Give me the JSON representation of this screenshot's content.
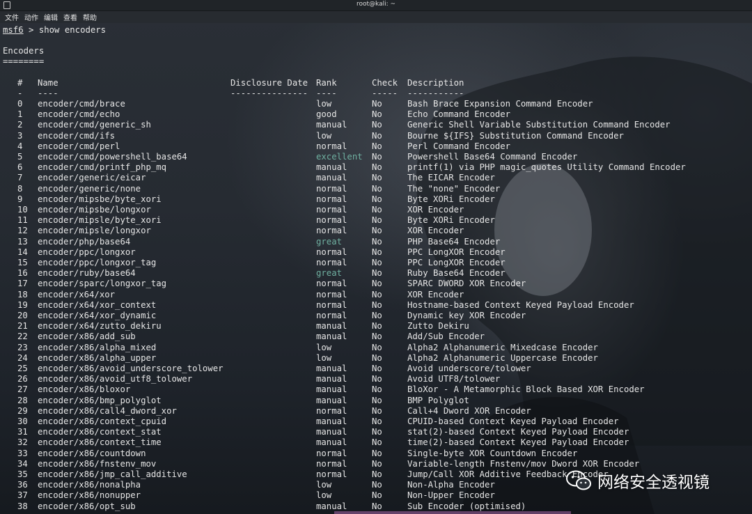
{
  "window": {
    "title": "root@kali: ~"
  },
  "menu": [
    "文件",
    "动作",
    "编辑",
    "查看",
    "帮助"
  ],
  "prompt": {
    "name": "msf6",
    "separator": " > ",
    "command": "show encoders"
  },
  "heading": "Encoders",
  "heading_underline": "========",
  "columns": {
    "num": "#",
    "name": "Name",
    "date": "Disclosure Date",
    "rank": "Rank",
    "check": "Check",
    "desc": "Description",
    "num_dash": "-",
    "name_dash": "----",
    "date_dash": "---------------",
    "rank_dash": "----",
    "check_dash": "-----",
    "desc_dash": "-----------"
  },
  "colors": {
    "rank_highlight": "#6fb0a0",
    "text": "#e6e6e6",
    "background": "#1b1f25"
  },
  "encoders": [
    {
      "num": "0",
      "name": "encoder/cmd/brace",
      "rank": "low",
      "check": "No",
      "desc": "Bash Brace Expansion Command Encoder"
    },
    {
      "num": "1",
      "name": "encoder/cmd/echo",
      "rank": "good",
      "check": "No",
      "desc": "Echo Command Encoder"
    },
    {
      "num": "2",
      "name": "encoder/cmd/generic_sh",
      "rank": "manual",
      "check": "No",
      "desc": "Generic Shell Variable Substitution Command Encoder"
    },
    {
      "num": "3",
      "name": "encoder/cmd/ifs",
      "rank": "low",
      "check": "No",
      "desc": "Bourne ${IFS} Substitution Command Encoder"
    },
    {
      "num": "4",
      "name": "encoder/cmd/perl",
      "rank": "normal",
      "check": "No",
      "desc": "Perl Command Encoder"
    },
    {
      "num": "5",
      "name": "encoder/cmd/powershell_base64",
      "rank": "excellent",
      "check": "No",
      "desc": "Powershell Base64 Command Encoder"
    },
    {
      "num": "6",
      "name": "encoder/cmd/printf_php_mq",
      "rank": "manual",
      "check": "No",
      "desc": "printf(1) via PHP magic_quotes Utility Command Encoder"
    },
    {
      "num": "7",
      "name": "encoder/generic/eicar",
      "rank": "manual",
      "check": "No",
      "desc": "The EICAR Encoder"
    },
    {
      "num": "8",
      "name": "encoder/generic/none",
      "rank": "normal",
      "check": "No",
      "desc": "The \"none\" Encoder"
    },
    {
      "num": "9",
      "name": "encoder/mipsbe/byte_xori",
      "rank": "normal",
      "check": "No",
      "desc": "Byte XORi Encoder"
    },
    {
      "num": "10",
      "name": "encoder/mipsbe/longxor",
      "rank": "normal",
      "check": "No",
      "desc": "XOR Encoder"
    },
    {
      "num": "11",
      "name": "encoder/mipsle/byte_xori",
      "rank": "normal",
      "check": "No",
      "desc": "Byte XORi Encoder"
    },
    {
      "num": "12",
      "name": "encoder/mipsle/longxor",
      "rank": "normal",
      "check": "No",
      "desc": "XOR Encoder"
    },
    {
      "num": "13",
      "name": "encoder/php/base64",
      "rank": "great",
      "check": "No",
      "desc": "PHP Base64 Encoder"
    },
    {
      "num": "14",
      "name": "encoder/ppc/longxor",
      "rank": "normal",
      "check": "No",
      "desc": "PPC LongXOR Encoder"
    },
    {
      "num": "15",
      "name": "encoder/ppc/longxor_tag",
      "rank": "normal",
      "check": "No",
      "desc": "PPC LongXOR Encoder"
    },
    {
      "num": "16",
      "name": "encoder/ruby/base64",
      "rank": "great",
      "check": "No",
      "desc": "Ruby Base64 Encoder"
    },
    {
      "num": "17",
      "name": "encoder/sparc/longxor_tag",
      "rank": "normal",
      "check": "No",
      "desc": "SPARC DWORD XOR Encoder"
    },
    {
      "num": "18",
      "name": "encoder/x64/xor",
      "rank": "normal",
      "check": "No",
      "desc": "XOR Encoder"
    },
    {
      "num": "19",
      "name": "encoder/x64/xor_context",
      "rank": "normal",
      "check": "No",
      "desc": "Hostname-based Context Keyed Payload Encoder"
    },
    {
      "num": "20",
      "name": "encoder/x64/xor_dynamic",
      "rank": "normal",
      "check": "No",
      "desc": "Dynamic key XOR Encoder"
    },
    {
      "num": "21",
      "name": "encoder/x64/zutto_dekiru",
      "rank": "manual",
      "check": "No",
      "desc": "Zutto Dekiru"
    },
    {
      "num": "22",
      "name": "encoder/x86/add_sub",
      "rank": "manual",
      "check": "No",
      "desc": "Add/Sub Encoder"
    },
    {
      "num": "23",
      "name": "encoder/x86/alpha_mixed",
      "rank": "low",
      "check": "No",
      "desc": "Alpha2 Alphanumeric Mixedcase Encoder"
    },
    {
      "num": "24",
      "name": "encoder/x86/alpha_upper",
      "rank": "low",
      "check": "No",
      "desc": "Alpha2 Alphanumeric Uppercase Encoder"
    },
    {
      "num": "25",
      "name": "encoder/x86/avoid_underscore_tolower",
      "rank": "manual",
      "check": "No",
      "desc": "Avoid underscore/tolower"
    },
    {
      "num": "26",
      "name": "encoder/x86/avoid_utf8_tolower",
      "rank": "manual",
      "check": "No",
      "desc": "Avoid UTF8/tolower"
    },
    {
      "num": "27",
      "name": "encoder/x86/bloxor",
      "rank": "manual",
      "check": "No",
      "desc": "BloXor - A Metamorphic Block Based XOR Encoder"
    },
    {
      "num": "28",
      "name": "encoder/x86/bmp_polyglot",
      "rank": "manual",
      "check": "No",
      "desc": "BMP Polyglot"
    },
    {
      "num": "29",
      "name": "encoder/x86/call4_dword_xor",
      "rank": "normal",
      "check": "No",
      "desc": "Call+4 Dword XOR Encoder"
    },
    {
      "num": "30",
      "name": "encoder/x86/context_cpuid",
      "rank": "manual",
      "check": "No",
      "desc": "CPUID-based Context Keyed Payload Encoder"
    },
    {
      "num": "31",
      "name": "encoder/x86/context_stat",
      "rank": "manual",
      "check": "No",
      "desc": "stat(2)-based Context Keyed Payload Encoder"
    },
    {
      "num": "32",
      "name": "encoder/x86/context_time",
      "rank": "manual",
      "check": "No",
      "desc": "time(2)-based Context Keyed Payload Encoder"
    },
    {
      "num": "33",
      "name": "encoder/x86/countdown",
      "rank": "normal",
      "check": "No",
      "desc": "Single-byte XOR Countdown Encoder"
    },
    {
      "num": "34",
      "name": "encoder/x86/fnstenv_mov",
      "rank": "normal",
      "check": "No",
      "desc": "Variable-length Fnstenv/mov Dword XOR Encoder"
    },
    {
      "num": "35",
      "name": "encoder/x86/jmp_call_additive",
      "rank": "normal",
      "check": "No",
      "desc": "Jump/Call XOR Additive Feedback Encoder"
    },
    {
      "num": "36",
      "name": "encoder/x86/nonalpha",
      "rank": "low",
      "check": "No",
      "desc": "Non-Alpha Encoder"
    },
    {
      "num": "37",
      "name": "encoder/x86/nonupper",
      "rank": "low",
      "check": "No",
      "desc": "Non-Upper Encoder"
    },
    {
      "num": "38",
      "name": "encoder/x86/opt_sub",
      "rank": "manual",
      "check": "No",
      "desc": "Sub Encoder (optimised)"
    }
  ],
  "watermark": {
    "text": "网络安全透视镜",
    "icon": "wechat-icon"
  }
}
